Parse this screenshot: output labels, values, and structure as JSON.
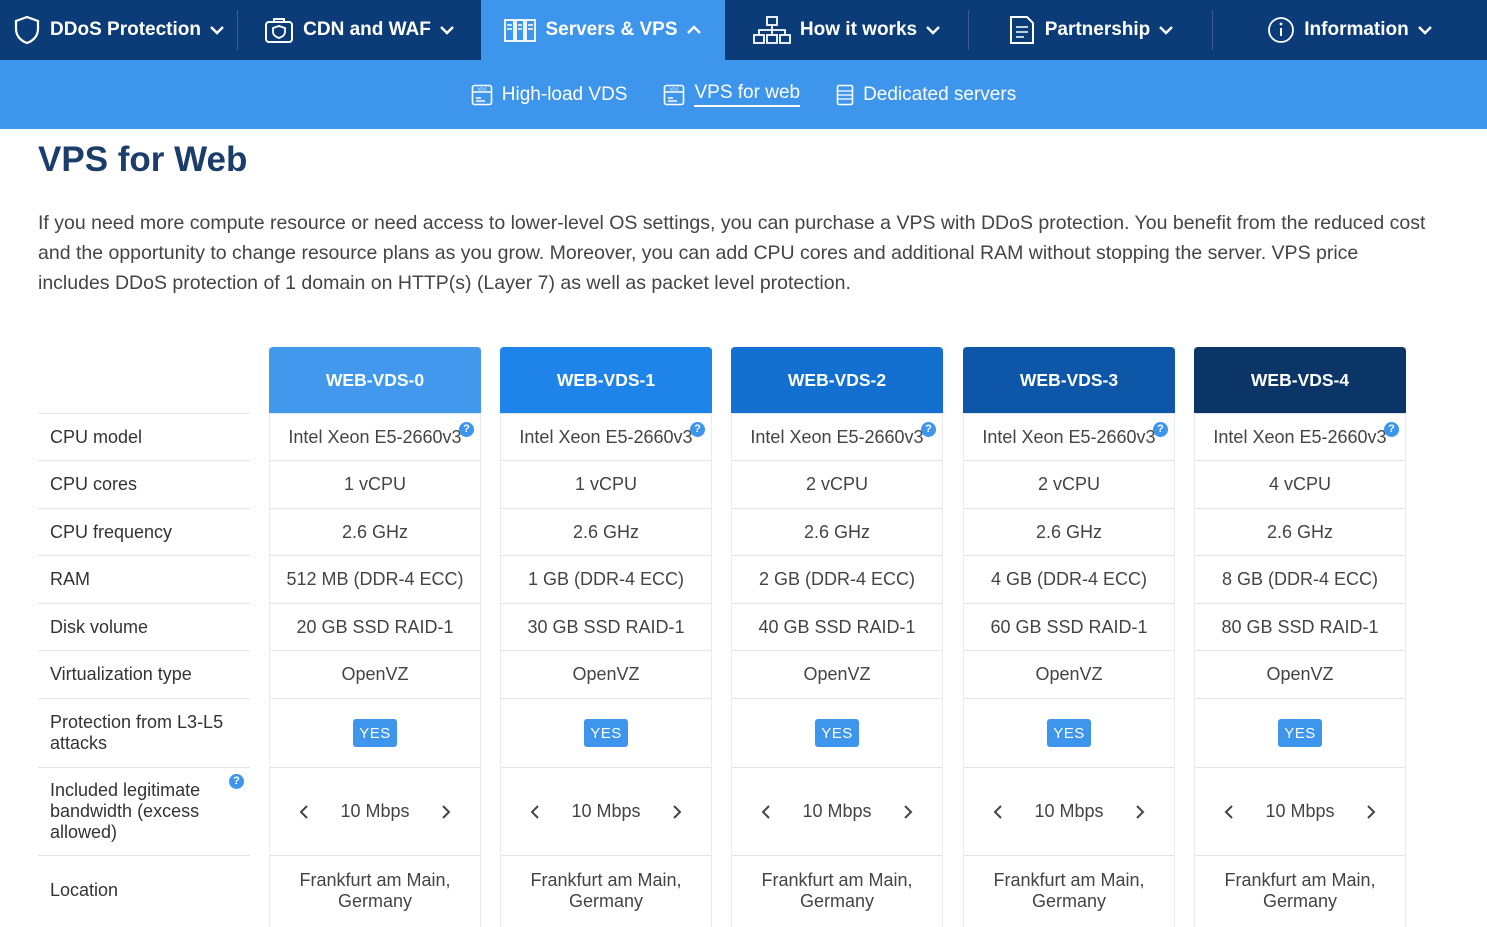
{
  "nav": {
    "items": [
      {
        "label": "DDoS Protection",
        "icon": "shield-icon",
        "chevron": "chevron-down-icon"
      },
      {
        "label": "CDN and WAF",
        "icon": "cdn-waf-icon",
        "chevron": "chevron-down-icon"
      },
      {
        "label": "Servers & VPS",
        "icon": "servers-icon",
        "chevron": "chevron-up-icon",
        "active": true
      },
      {
        "label": "How it works",
        "icon": "network-icon",
        "chevron": "chevron-down-icon"
      },
      {
        "label": "Partnership",
        "icon": "document-icon",
        "chevron": "chevron-down-icon"
      },
      {
        "label": "Information",
        "icon": "info-icon",
        "chevron": "chevron-down-icon"
      }
    ],
    "active_color": "#3d95ec",
    "bar_color": "#0c3c78"
  },
  "subnav": {
    "items": [
      {
        "label": "High-load VDS",
        "icon": "vds-icon"
      },
      {
        "label": "VPS for web",
        "icon": "vds-icon",
        "current": true
      },
      {
        "label": "Dedicated servers",
        "icon": "server-rack-icon"
      }
    ]
  },
  "page": {
    "title": "VPS for Web",
    "intro": "If you need more compute resource or need access to lower-level OS settings, you can purchase a VPS with DDoS protection. You benefit from the reduced cost and the opportunity to change resource plans as you grow. Moreover, you can add CPU cores and additional RAM without stopping the server. VPS price includes DDoS protection of 1 domain on HTTP(s) (Layer 7) as well as packet level protection."
  },
  "table": {
    "row_labels": [
      "CPU model",
      "CPU cores",
      "CPU frequency",
      "RAM",
      "Disk volume",
      "Virtualization type",
      "Protection from L3-L5 attacks",
      "Included legitimate bandwidth (excess allowed)",
      "Location"
    ],
    "help_mark": "?",
    "plans": [
      {
        "name": "WEB-VDS-0",
        "color": "#4198ec",
        "cpu_model": "Intel Xeon E5-2660v3",
        "cpu_cores": "1 vCPU",
        "cpu_freq": "2.6 GHz",
        "ram": "512 MB (DDR-4 ECC)",
        "disk": "20 GB SSD RAID-1",
        "virt": "OpenVZ",
        "protection": "YES",
        "bandwidth": "10 Mbps",
        "location": "Frankfurt am Main, Germany"
      },
      {
        "name": "WEB-VDS-1",
        "color": "#1e84ea",
        "cpu_model": "Intel Xeon E5-2660v3",
        "cpu_cores": "1 vCPU",
        "cpu_freq": "2.6 GHz",
        "ram": "1 GB (DDR-4 ECC)",
        "disk": "30 GB SSD RAID-1",
        "virt": "OpenVZ",
        "protection": "YES",
        "bandwidth": "10 Mbps",
        "location": "Frankfurt am Main, Germany"
      },
      {
        "name": "WEB-VDS-2",
        "color": "#136fd0",
        "cpu_model": "Intel Xeon E5-2660v3",
        "cpu_cores": "2 vCPU",
        "cpu_freq": "2.6 GHz",
        "ram": "2 GB (DDR-4 ECC)",
        "disk": "40 GB SSD RAID-1",
        "virt": "OpenVZ",
        "protection": "YES",
        "bandwidth": "10 Mbps",
        "location": "Frankfurt am Main, Germany"
      },
      {
        "name": "WEB-VDS-3",
        "color": "#0e56a8",
        "cpu_model": "Intel Xeon E5-2660v3",
        "cpu_cores": "2 vCPU",
        "cpu_freq": "2.6 GHz",
        "ram": "4 GB (DDR-4 ECC)",
        "disk": "60 GB SSD RAID-1",
        "virt": "OpenVZ",
        "protection": "YES",
        "bandwidth": "10 Mbps",
        "location": "Frankfurt am Main, Germany"
      },
      {
        "name": "WEB-VDS-4",
        "color": "#0a3566",
        "cpu_model": "Intel Xeon E5-2660v3",
        "cpu_cores": "4 vCPU",
        "cpu_freq": "2.6 GHz",
        "ram": "8 GB (DDR-4 ECC)",
        "disk": "80 GB SSD RAID-1",
        "virt": "OpenVZ",
        "protection": "YES",
        "bandwidth": "10 Mbps",
        "location": "Frankfurt am Main, Germany"
      }
    ]
  }
}
